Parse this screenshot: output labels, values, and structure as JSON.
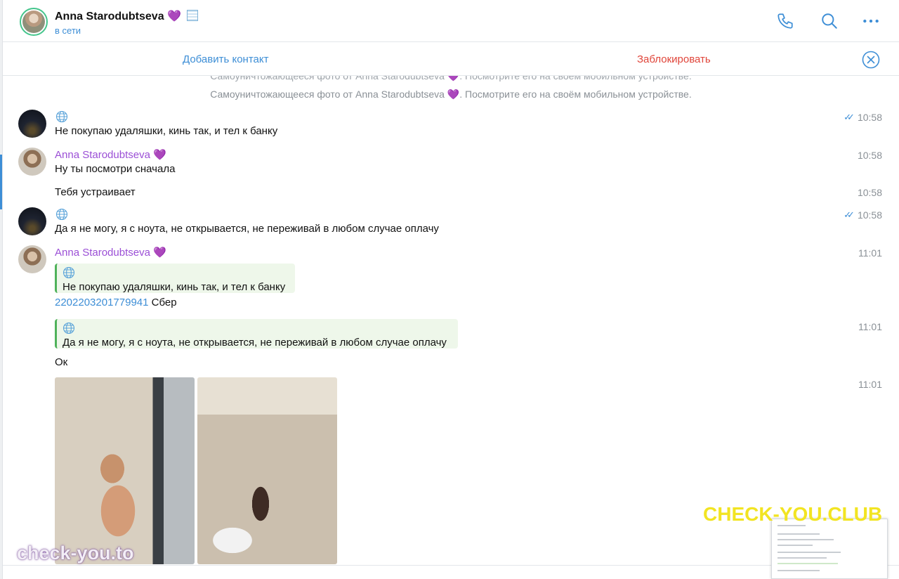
{
  "header": {
    "name": "Anna Starodubtseva",
    "name_emoji": "💜",
    "status": "в сети"
  },
  "actions": {
    "add_contact": "Добавить контакт",
    "block": "Заблокировать"
  },
  "chat": {
    "service_cut": "Самоуничтожающееся фото от Anna Starodubtseva 💜. Посмотрите его на своём мобильном устройстве.",
    "service": "Самоуничтожающееся фото от Anna Starodubtseva",
    "service_tail": ". Посмотрите его на своём мобильном устройстве.",
    "messages": [
      {
        "text": "Не покупаю удаляшки, кинь так, и тел к банку",
        "time": "10:58"
      },
      {
        "sender": "Anna Starodubtseva",
        "text": "Ну ты посмотри сначала",
        "time": "10:58"
      },
      {
        "text": "Тебя устраивает",
        "time": "10:58"
      },
      {
        "text": "Да я не могу, я с ноута, не открывается, не переживай в любом случае оплачу",
        "time": "10:58"
      },
      {
        "sender": "Anna Starodubtseva",
        "time": "11:01",
        "reply_text": "Не покупаю удаляшки, кинь так, и тел к банку",
        "link": "2202203201779941",
        "text_after_link": " Сбер"
      },
      {
        "time": "11:01",
        "reply_text": "Да я не могу, я с ноута, не открывается, не переживай в любом случае оплачу",
        "text": "Ок"
      },
      {
        "time": "11:01"
      }
    ]
  },
  "watermarks": {
    "right": "CHECK-YOU.CLUB",
    "left": "check-you.to"
  },
  "colors": {
    "accent": "#3d8ed6",
    "sender": "#9b4fd6",
    "danger": "#e0453a",
    "reply_bar": "#4fb25a",
    "online_ring": "#45c58c"
  }
}
